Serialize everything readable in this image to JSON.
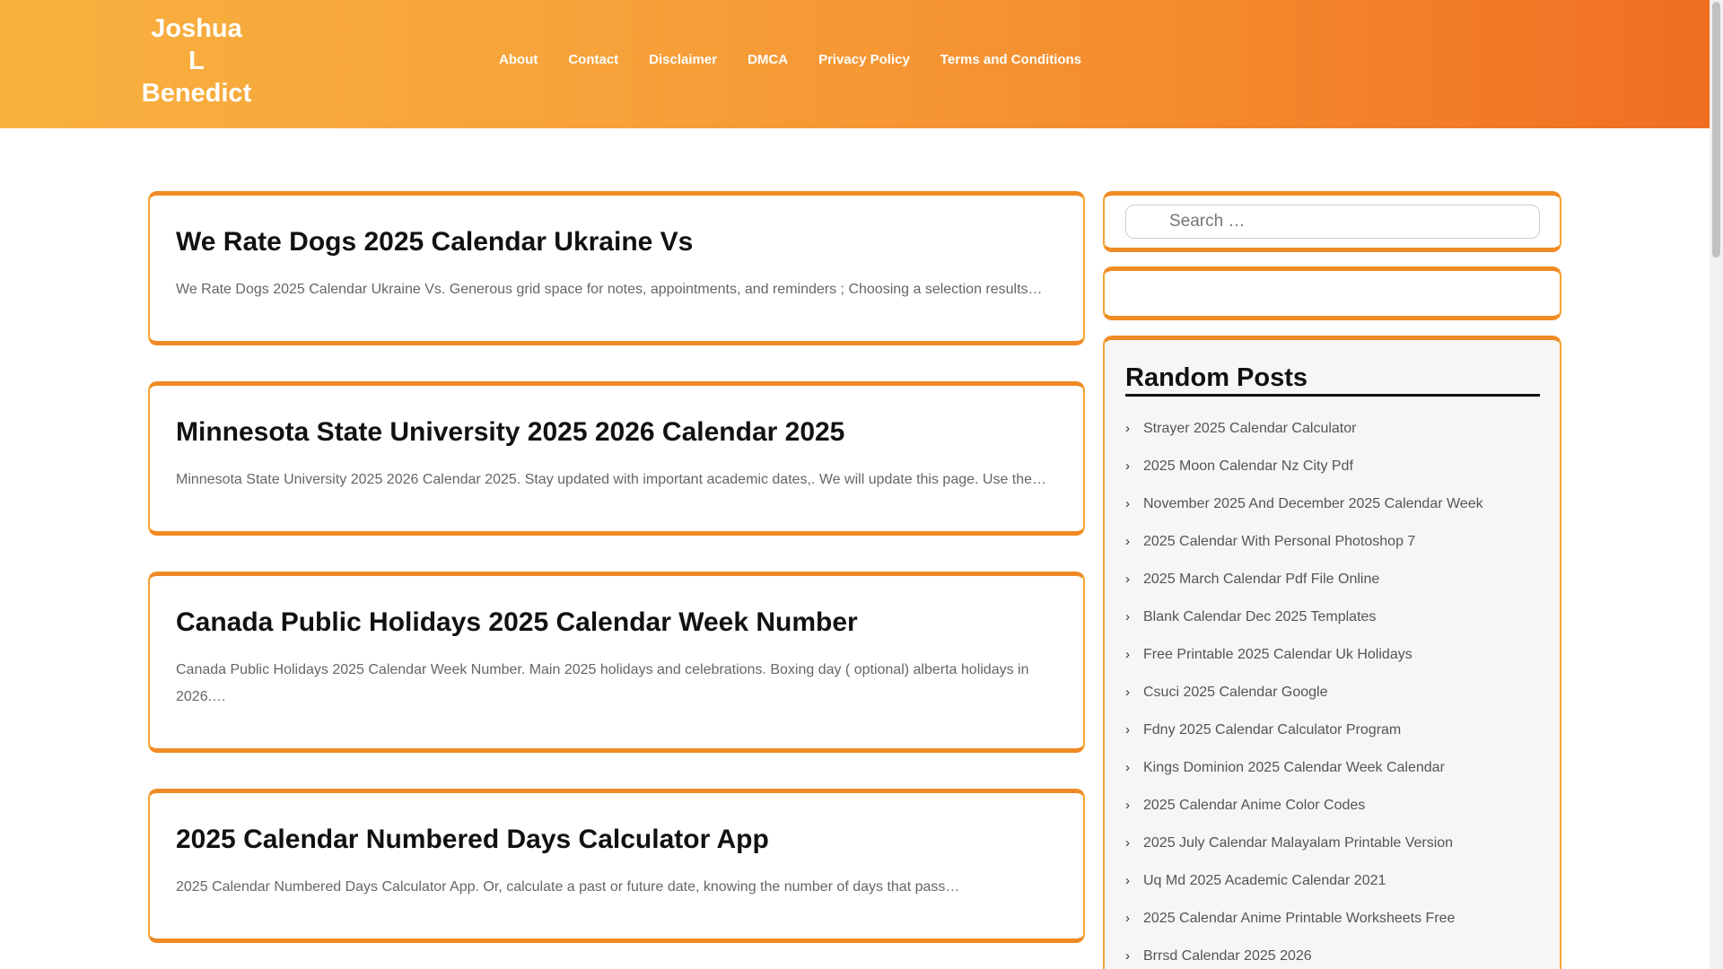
{
  "header": {
    "brand_line1": "Joshua",
    "brand_line2": "L",
    "brand_line3": "Benedict",
    "nav": [
      "About",
      "Contact",
      "Disclaimer",
      "DMCA",
      "Privacy Policy",
      "Terms and Conditions"
    ]
  },
  "posts": [
    {
      "title": "We Rate Dogs 2025 Calendar Ukraine Vs",
      "excerpt": "We Rate Dogs 2025 Calendar Ukraine Vs. Generous grid space for notes, appointments, and reminders ; Choosing a selection results…"
    },
    {
      "title": "Minnesota State University 2025 2026 Calendar 2025",
      "excerpt": "Minnesota State University 2025 2026 Calendar 2025. Stay updated with important academic dates,. We will update this page. Use the…"
    },
    {
      "title": "Canada Public Holidays 2025 Calendar Week Number",
      "excerpt": "Canada Public Holidays 2025 Calendar Week Number. Main 2025 holidays and celebrations. Boxing day ( optional) alberta holidays in 2026.…"
    },
    {
      "title": "2025 Calendar Numbered Days Calculator App",
      "excerpt": "2025 Calendar Numbered Days Calculator App. Or, calculate a past or future date, knowing the number of days that pass…"
    }
  ],
  "sidebar": {
    "search_placeholder": "Search …",
    "random_posts_title": "Random Posts",
    "random_posts": [
      "Strayer 2025 Calendar Calculator",
      "2025 Moon Calendar Nz City Pdf",
      "November 2025 And December 2025 Calendar Week",
      "2025 Calendar With Personal Photoshop 7",
      "2025 March Calendar Pdf File Online",
      "Blank Calendar Dec 2025 Templates",
      "Free Printable 2025 Calendar Uk Holidays",
      "Csuci 2025 Calendar Google",
      "Fdny 2025 Calendar Calculator Program",
      "Kings Dominion 2025 Calendar Week Calendar",
      "2025 Calendar Anime Color Codes",
      "2025 July Calendar Malayalam Printable Version",
      "Uq Md 2025 Academic Calendar 2021",
      "2025 Calendar Anime Printable Worksheets Free",
      "Brrsd Calendar 2025 2026"
    ]
  },
  "colors": {
    "header_gradient_start": "#f8b13f",
    "header_gradient_end": "#f06e22",
    "card_border": "#f08a24"
  }
}
